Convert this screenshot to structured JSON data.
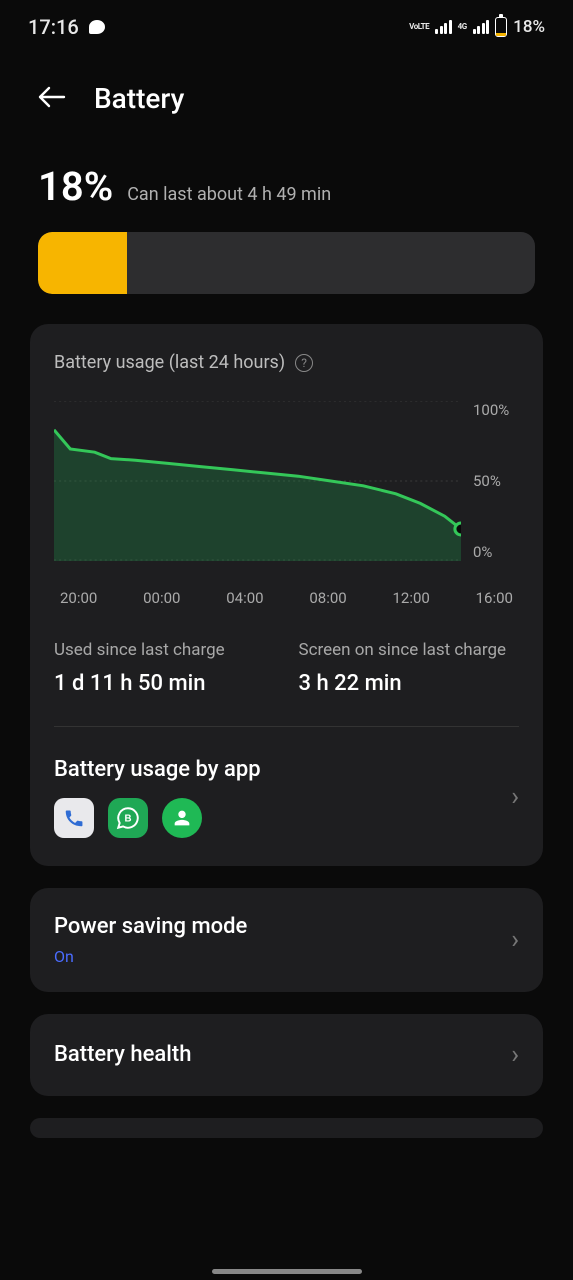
{
  "status_bar": {
    "time": "17:16",
    "net1": "VoLTE",
    "net2": "4G",
    "battery_pct": "18%"
  },
  "header": {
    "title": "Battery"
  },
  "summary": {
    "pct": "18%",
    "estimate": "Can last about 4 h 49 min",
    "fill_pct": 18
  },
  "usage_card": {
    "title": "Battery usage (last 24 hours)",
    "ylabels": {
      "top": "100%",
      "mid": "50%",
      "bot": "0%"
    },
    "xlabels": [
      "20:00",
      "00:00",
      "04:00",
      "08:00",
      "12:00",
      "16:00"
    ],
    "used_label": "Used since last charge",
    "used_value": "1 d 11 h 50 min",
    "screen_label": "Screen on since last charge",
    "screen_value": "3 h 22 min",
    "by_app_title": "Battery usage by app",
    "app_icons": [
      "phone-icon",
      "whatsapp-business-icon",
      "contacts-icon"
    ]
  },
  "chart_data": {
    "type": "area",
    "x": [
      0,
      0.04,
      0.1,
      0.14,
      0.2,
      0.28,
      0.36,
      0.44,
      0.52,
      0.6,
      0.68,
      0.76,
      0.84,
      0.9,
      0.96,
      1.0
    ],
    "y": [
      82,
      70,
      68,
      64,
      63,
      61,
      59,
      57,
      55,
      53,
      50,
      47,
      42,
      36,
      28,
      20
    ],
    "title": "Battery usage (last 24 hours)",
    "xlabel": "",
    "ylabel": "",
    "ylim": [
      0,
      100
    ],
    "x_ticks": [
      "20:00",
      "00:00",
      "04:00",
      "08:00",
      "12:00",
      "16:00"
    ]
  },
  "power_saving": {
    "title": "Power saving mode",
    "status": "On"
  },
  "battery_health": {
    "title": "Battery health"
  }
}
